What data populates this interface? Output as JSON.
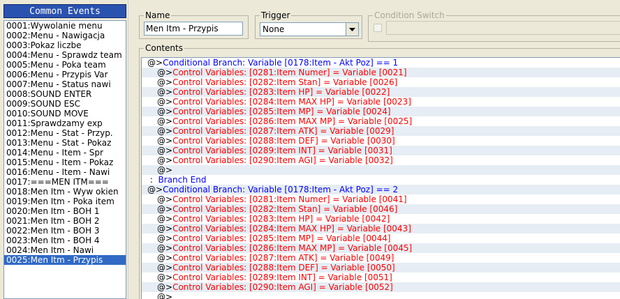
{
  "common_events": {
    "title": "Common Events",
    "selected_index": 24,
    "items": [
      "0001:Wywolanie menu",
      "0002:Menu - Nawigacja",
      "0003:Pokaz liczbe",
      "0004:Menu - Sprawdz team",
      "0005:Menu - Poka team",
      "0006:Menu - Przypis Var",
      "0007:Menu - Status nawi",
      "0008:SOUND ENTER",
      "0009:SOUND ESC",
      "0010:SOUND MOVE",
      "0011:Sprawdzamy exp",
      "0012:Menu - Stat - Przyp.",
      "0013:Menu - Stat - Pokaz",
      "0014:Menu - Item - Spr",
      "0015:Menu - Item - Pokaz",
      "0016:Menu - Item - Nawi",
      "0017:===MEN ITM===",
      "0018:Men Itm - Wyw okien",
      "0019:Men Itm - Poka item",
      "0020:Men Itm - BOH 1",
      "0021:Men Itm - BOH 2",
      "0022:Men Itm - BOH 3",
      "0023:Men Itm - BOH 4",
      "0024:Men Itm - Nawi",
      "0025:Men Itm - Przypis"
    ]
  },
  "name": {
    "label": "Name",
    "value": "Men Itm - Przypis"
  },
  "trigger": {
    "label": "Trigger",
    "value": "None"
  },
  "condition_switch": {
    "label": "Condition Switch",
    "value": ""
  },
  "contents": {
    "label": "Contents",
    "rows": [
      {
        "indent": 0,
        "prefix": "@>",
        "text": "Conditional Branch: Variable [0178:Item - Akt Poz] == 1",
        "color": "blue"
      },
      {
        "indent": 1,
        "prefix": "@>",
        "text": "Control Variables: [0281:Item Numer] = Variable [0021]",
        "color": "red"
      },
      {
        "indent": 1,
        "prefix": "@>",
        "text": "Control Variables: [0282:Item Stan] = Variable [0026]",
        "color": "red"
      },
      {
        "indent": 1,
        "prefix": "@>",
        "text": "Control Variables: [0283:Item HP] = Variable [0022]",
        "color": "red"
      },
      {
        "indent": 1,
        "prefix": "@>",
        "text": "Control Variables: [0284:Item MAX HP] = Variable [0023]",
        "color": "red"
      },
      {
        "indent": 1,
        "prefix": "@>",
        "text": "Control Variables: [0285:Item MP] = Variable [0024]",
        "color": "red"
      },
      {
        "indent": 1,
        "prefix": "@>",
        "text": "Control Variables: [0286:Item MAX MP] = Variable [0025]",
        "color": "red"
      },
      {
        "indent": 1,
        "prefix": "@>",
        "text": "Control Variables: [0287:Item ATK] = Variable [0029]",
        "color": "red"
      },
      {
        "indent": 1,
        "prefix": "@>",
        "text": "Control Variables: [0288:Item DEF] = Variable [0030]",
        "color": "red"
      },
      {
        "indent": 1,
        "prefix": "@>",
        "text": "Control Variables: [0289:Item INT] = Variable [0031]",
        "color": "red"
      },
      {
        "indent": 1,
        "prefix": "@>",
        "text": "Control Variables: [0290:Item AGI] = Variable [0032]",
        "color": "red"
      },
      {
        "indent": 1,
        "prefix": "@>",
        "text": "",
        "color": "black"
      },
      {
        "indent": 0,
        "prefix": " :  ",
        "text": "Branch End",
        "color": "blue"
      },
      {
        "indent": 0,
        "prefix": "@>",
        "text": "Conditional Branch: Variable [0178:Item - Akt Poz] == 2",
        "color": "blue"
      },
      {
        "indent": 1,
        "prefix": "@>",
        "text": "Control Variables: [0281:Item Numer] = Variable [0041]",
        "color": "red"
      },
      {
        "indent": 1,
        "prefix": "@>",
        "text": "Control Variables: [0282:Item Stan] = Variable [0046]",
        "color": "red"
      },
      {
        "indent": 1,
        "prefix": "@>",
        "text": "Control Variables: [0283:Item HP] = Variable [0042]",
        "color": "red"
      },
      {
        "indent": 1,
        "prefix": "@>",
        "text": "Control Variables: [0284:Item MAX HP] = Variable [0043]",
        "color": "red"
      },
      {
        "indent": 1,
        "prefix": "@>",
        "text": "Control Variables: [0285:Item MP] = Variable [0044]",
        "color": "red"
      },
      {
        "indent": 1,
        "prefix": "@>",
        "text": "Control Variables: [0286:Item MAX MP] = Variable [0045]",
        "color": "red"
      },
      {
        "indent": 1,
        "prefix": "@>",
        "text": "Control Variables: [0287:Item ATK] = Variable [0049]",
        "color": "red"
      },
      {
        "indent": 1,
        "prefix": "@>",
        "text": "Control Variables: [0288:Item DEF] = Variable [0050]",
        "color": "red"
      },
      {
        "indent": 1,
        "prefix": "@>",
        "text": "Control Variables: [0289:Item INT] = Variable [0051]",
        "color": "red"
      },
      {
        "indent": 1,
        "prefix": "@>",
        "text": "Control Variables: [0290:Item AGI] = Variable [0052]",
        "color": "red"
      },
      {
        "indent": 1,
        "prefix": "@>",
        "text": "",
        "color": "black"
      }
    ]
  },
  "colors": {
    "header_bg": "#2a53b0",
    "selection_bg": "#316ac5",
    "command_red": "#ff0000",
    "command_blue": "#0000ff",
    "alt_row": "#e6edf4"
  }
}
